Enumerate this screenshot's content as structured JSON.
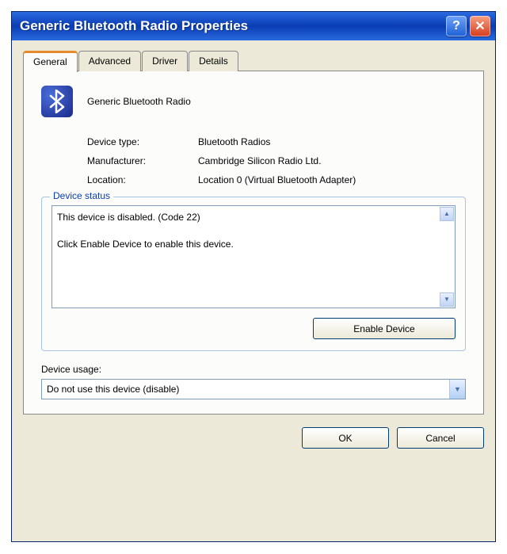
{
  "window": {
    "title": "Generic Bluetooth Radio Properties"
  },
  "tabs": [
    {
      "label": "General",
      "active": true
    },
    {
      "label": "Advanced",
      "active": false
    },
    {
      "label": "Driver",
      "active": false
    },
    {
      "label": "Details",
      "active": false
    }
  ],
  "device": {
    "icon": "bluetooth-icon",
    "name": "Generic Bluetooth Radio",
    "type_label": "Device type:",
    "type_value": "Bluetooth Radios",
    "manufacturer_label": "Manufacturer:",
    "manufacturer_value": "Cambridge Silicon Radio Ltd.",
    "location_label": "Location:",
    "location_value": "Location 0 (Virtual Bluetooth Adapter)"
  },
  "status": {
    "legend": "Device status",
    "line1": "This device is disabled. (Code 22)",
    "line2": "Click Enable Device to enable this device.",
    "enable_button": "Enable Device"
  },
  "usage": {
    "label": "Device usage:",
    "selected": "Do not use this device (disable)"
  },
  "buttons": {
    "ok": "OK",
    "cancel": "Cancel"
  }
}
